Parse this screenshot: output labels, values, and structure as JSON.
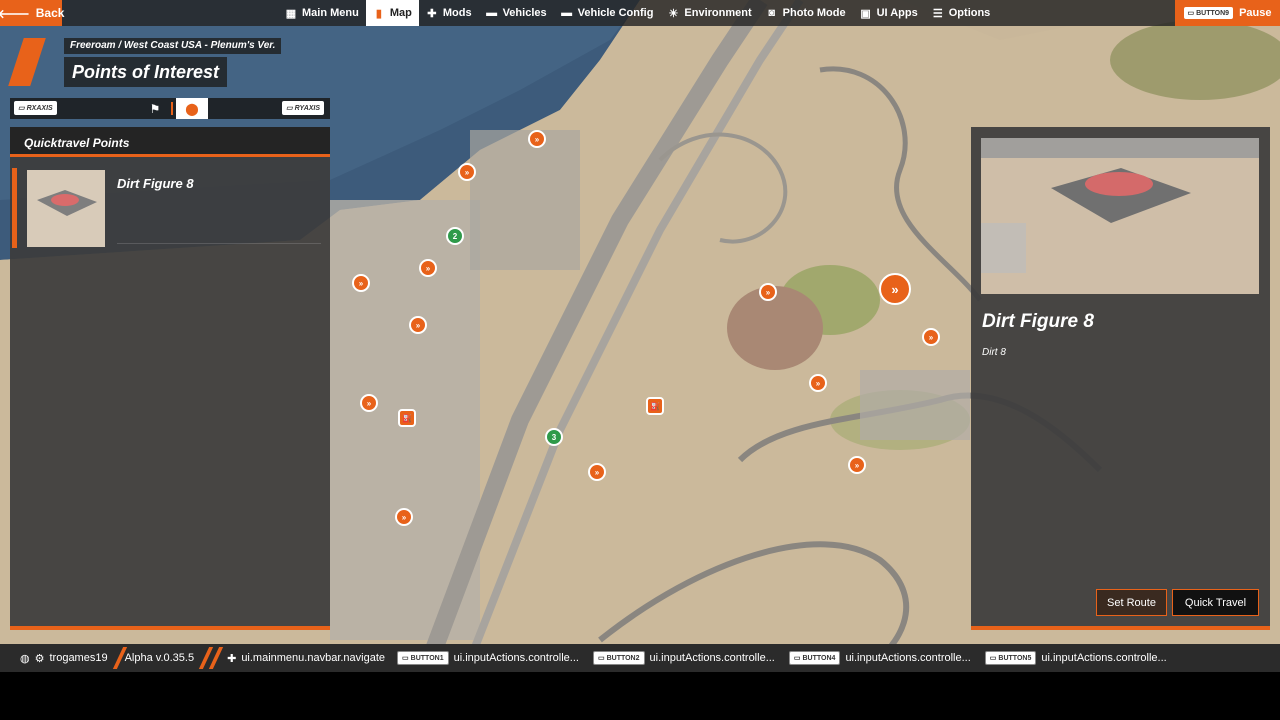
{
  "nav": {
    "back_label": "Back",
    "items": [
      {
        "label": "Main Menu",
        "icon": "grid-icon"
      },
      {
        "label": "Map",
        "icon": "map-icon",
        "active": true
      },
      {
        "label": "Mods",
        "icon": "puzzle-icon"
      },
      {
        "label": "Vehicles",
        "icon": "car-icon"
      },
      {
        "label": "Vehicle Config",
        "icon": "car-config-icon"
      },
      {
        "label": "Environment",
        "icon": "sun-icon"
      },
      {
        "label": "Photo Mode",
        "icon": "camera-icon"
      },
      {
        "label": "UI Apps",
        "icon": "apps-icon"
      },
      {
        "label": "Options",
        "icon": "sliders-icon"
      }
    ],
    "pause_badge": "BUTTON9",
    "pause_label": "Pause"
  },
  "header": {
    "breadcrumb": "Freeroam / West Coast USA - Plenum's Ver.",
    "title": "Points of Interest"
  },
  "tabbar": {
    "left_badge": "RXAXIS",
    "right_badge": "RYAXIS"
  },
  "left_panel": {
    "title": "Quicktravel Points",
    "items": [
      {
        "label": "Dirt Figure 8"
      }
    ]
  },
  "right_panel": {
    "title": "Dirt Figure 8",
    "description": "Dirt 8",
    "set_route_label": "Set Route",
    "quick_travel_label": "Quick Travel"
  },
  "map_markers": {
    "green_2": "2",
    "green_3": "3",
    "glyph": "»"
  },
  "statusbar": {
    "username": "trogames19",
    "version": "Alpha v.0.35.5",
    "navigate": "ui.mainmenu.navbar.navigate",
    "actions": [
      {
        "badge": "BUTTON1",
        "text": "ui.inputActions.controlle..."
      },
      {
        "badge": "BUTTON2",
        "text": "ui.inputActions.controlle..."
      },
      {
        "badge": "BUTTON4",
        "text": "ui.inputActions.controlle..."
      },
      {
        "badge": "BUTTON5",
        "text": "ui.inputActions.controlle..."
      }
    ]
  },
  "colors": {
    "accent": "#e8621a",
    "panel": "#3c3c3c",
    "map_sand": "#c9b79a",
    "water": "#3b5a7a",
    "marker_green": "#2f9a4a"
  }
}
